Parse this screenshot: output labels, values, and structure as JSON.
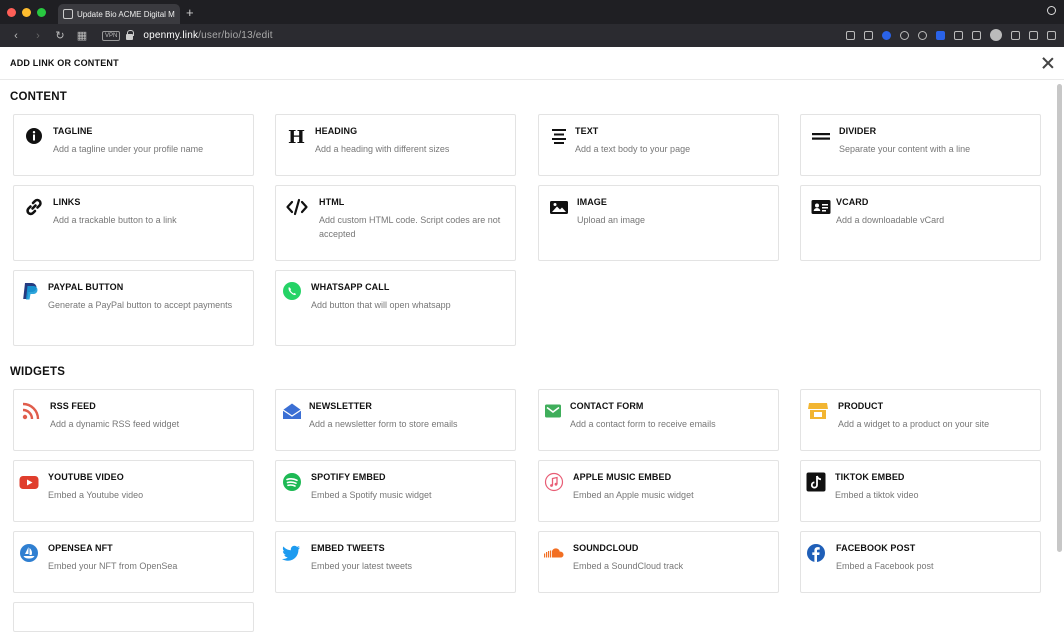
{
  "browser": {
    "tab_title": "Update Bio ACME Digital Marke",
    "new_tab": "+",
    "vpn_label": "VPN",
    "url_host": "openmy.link",
    "url_path": "/user/bio/13/edit"
  },
  "modal": {
    "title": "ADD LINK OR CONTENT"
  },
  "sections": {
    "content_title": "CONTENT",
    "widgets_title": "WIDGETS"
  },
  "content_cards": [
    {
      "title": "TAGLINE",
      "desc": "Add a tagline under your profile name",
      "icon": "info-icon"
    },
    {
      "title": "HEADING",
      "desc": "Add a heading with different sizes",
      "icon": "heading-icon"
    },
    {
      "title": "TEXT",
      "desc": "Add a text body to your page",
      "icon": "text-align-icon"
    },
    {
      "title": "DIVIDER",
      "desc": "Separate your content with a line",
      "icon": "divider-icon"
    },
    {
      "title": "LINKS",
      "desc": "Add a trackable button to a link",
      "icon": "link-icon"
    },
    {
      "title": "HTML",
      "desc": "Add custom HTML code. Script codes are not accepted",
      "icon": "code-icon"
    },
    {
      "title": "IMAGE",
      "desc": "Upload an image",
      "icon": "image-icon"
    },
    {
      "title": "VCARD",
      "desc": "Add a downloadable vCard",
      "icon": "vcard-icon"
    },
    {
      "title": "PAYPAL BUTTON",
      "desc": "Generate a PayPal button to accept payments",
      "icon": "paypal-icon"
    },
    {
      "title": "WHATSAPP CALL",
      "desc": "Add button that will open whatsapp",
      "icon": "whatsapp-icon"
    }
  ],
  "widget_cards": [
    {
      "title": "RSS FEED",
      "desc": "Add a dynamic RSS feed widget",
      "icon": "rss-icon"
    },
    {
      "title": "NEWSLETTER",
      "desc": "Add a newsletter form to store emails",
      "icon": "envelope-open-icon"
    },
    {
      "title": "CONTACT FORM",
      "desc": "Add a contact form to receive emails",
      "icon": "contact-form-icon"
    },
    {
      "title": "PRODUCT",
      "desc": "Add a widget to a product on your site",
      "icon": "store-icon"
    },
    {
      "title": "YOUTUBE VIDEO",
      "desc": "Embed a Youtube video",
      "icon": "youtube-icon"
    },
    {
      "title": "SPOTIFY EMBED",
      "desc": "Embed a Spotify music widget",
      "icon": "spotify-icon"
    },
    {
      "title": "APPLE MUSIC EMBED",
      "desc": "Embed an Apple music widget",
      "icon": "apple-music-icon"
    },
    {
      "title": "TIKTOK EMBED",
      "desc": "Embed a tiktok video",
      "icon": "tiktok-icon"
    },
    {
      "title": "OPENSEA NFT",
      "desc": "Embed your NFT from OpenSea",
      "icon": "opensea-icon"
    },
    {
      "title": "EMBED TWEETS",
      "desc": "Embed your latest tweets",
      "icon": "twitter-icon"
    },
    {
      "title": "SOUNDCLOUD",
      "desc": "Embed a SoundCloud track",
      "icon": "soundcloud-icon"
    },
    {
      "title": "FACEBOOK POST",
      "desc": "Embed a Facebook post",
      "icon": "facebook-icon"
    }
  ]
}
